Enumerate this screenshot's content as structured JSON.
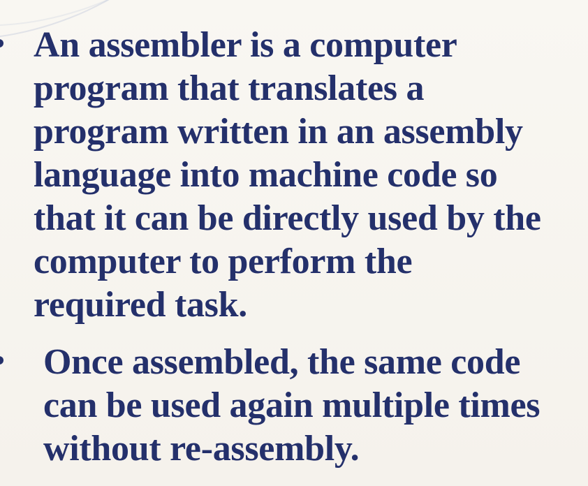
{
  "slide": {
    "bullets": [
      {
        "lines": [
          "An assembler is a computer",
          "program that translates a",
          "program written in an assembly",
          "language into machine code so",
          "that it can be directly used by the",
          "computer to perform the",
          "required task."
        ]
      },
      {
        "lines": [
          "Once assembled, the same code",
          "can be used again multiple times",
          "without re-assembly."
        ]
      }
    ]
  },
  "colors": {
    "text": "#24306b",
    "background": "#f7f4ee"
  }
}
